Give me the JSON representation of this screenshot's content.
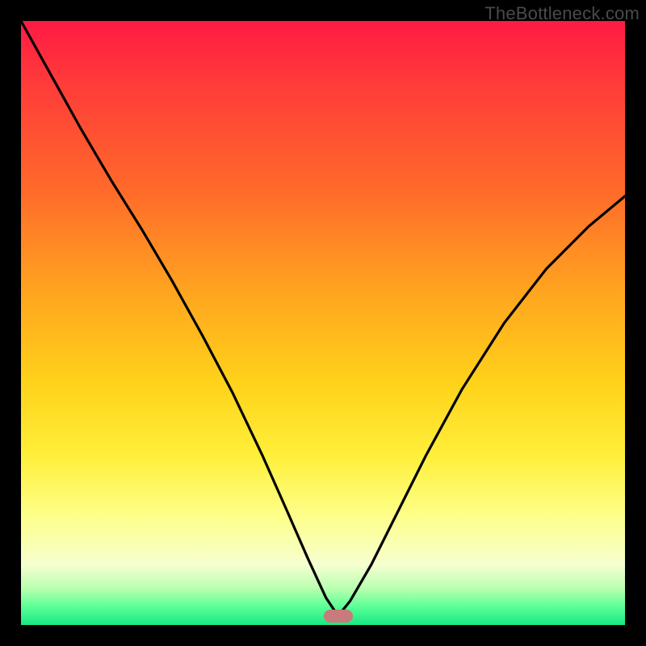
{
  "watermark": {
    "text": "TheBottleneck.com"
  },
  "marker": {
    "x_frac": 0.525,
    "y_frac": 0.985,
    "color": "#c97a7a"
  },
  "chart_data": {
    "type": "line",
    "title": "",
    "xlabel": "",
    "ylabel": "",
    "xlim": [
      0,
      1
    ],
    "ylim": [
      0,
      1
    ],
    "legend": false,
    "grid": false,
    "annotations": [
      "TheBottleneck.com"
    ],
    "series": [
      {
        "name": "curve",
        "comment": "V-shaped curve. x and y are fractions of the plot area (0 = left/top edge adjacent to black frame, 1 = right/bottom). Minimum near x≈0.525 touching the bottom.",
        "x": [
          0.0,
          0.05,
          0.1,
          0.15,
          0.2,
          0.25,
          0.3,
          0.35,
          0.4,
          0.44,
          0.475,
          0.505,
          0.525,
          0.545,
          0.58,
          0.62,
          0.67,
          0.73,
          0.8,
          0.87,
          0.94,
          1.0
        ],
        "y": [
          0.0,
          0.09,
          0.18,
          0.265,
          0.345,
          0.43,
          0.52,
          0.615,
          0.72,
          0.81,
          0.89,
          0.955,
          0.985,
          0.96,
          0.9,
          0.82,
          0.72,
          0.61,
          0.5,
          0.41,
          0.34,
          0.29
        ]
      }
    ],
    "background_gradient_stops": [
      {
        "pos": 0.0,
        "color": "#ff1a44"
      },
      {
        "pos": 0.1,
        "color": "#ff3a3a"
      },
      {
        "pos": 0.28,
        "color": "#ff6a2a"
      },
      {
        "pos": 0.45,
        "color": "#ffa51f"
      },
      {
        "pos": 0.6,
        "color": "#ffd21a"
      },
      {
        "pos": 0.72,
        "color": "#ffef3a"
      },
      {
        "pos": 0.82,
        "color": "#fdff8a"
      },
      {
        "pos": 0.9,
        "color": "#f6ffd0"
      },
      {
        "pos": 0.94,
        "color": "#b8ffb0"
      },
      {
        "pos": 0.97,
        "color": "#5aff96"
      },
      {
        "pos": 1.0,
        "color": "#18e884"
      }
    ],
    "marker": {
      "x": 0.525,
      "y": 0.985,
      "shape": "rounded-rect",
      "color": "#c97a7a"
    }
  }
}
